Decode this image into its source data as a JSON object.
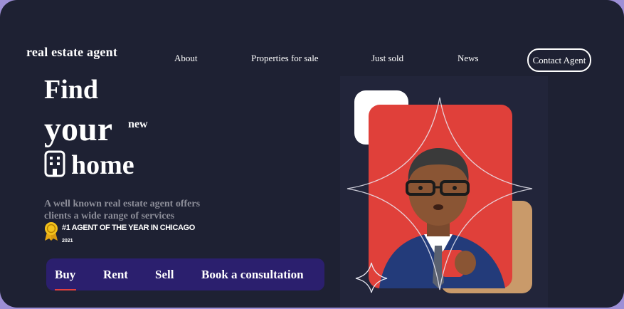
{
  "header": {
    "logo": "real estate agent",
    "nav": [
      "About",
      "Properties for sale",
      "Just sold",
      "News"
    ],
    "cta": "Contact Agent"
  },
  "hero": {
    "line1": "Find",
    "line2": "your",
    "badge": "new",
    "line3": "home",
    "subtitle": "A well known real estate agent offers clients a wide range of services",
    "award": "#1 AGENT OF THE YEAR IN CHICAGO",
    "year": "2021"
  },
  "tabs": [
    "Buy",
    "Rent",
    "Sell",
    "Book a consultation"
  ],
  "colors": {
    "background": "#1e2133",
    "tab_bar": "#2b1f6e",
    "accent_red": "#e0403a",
    "accent_tan": "#c99a6a",
    "award_gold": "#f3c21c"
  },
  "icons": [
    "building-icon",
    "award-ribbon-icon",
    "sparkle-star-icon"
  ]
}
